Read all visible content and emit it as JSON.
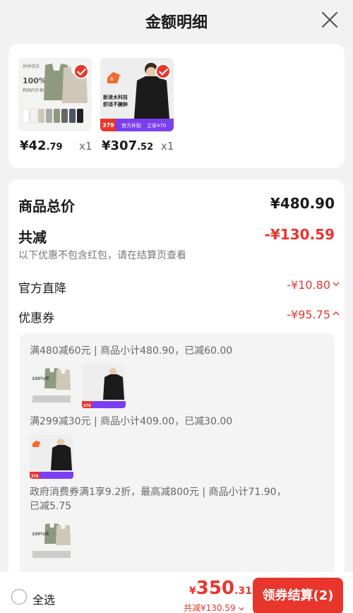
{
  "header": {
    "title": "金额明细"
  },
  "products": [
    {
      "price_main": "¥42",
      "price_frac": ".79",
      "qty": "x1",
      "badge_text": "100%棉",
      "image_desc": "vest-product-image"
    },
    {
      "price_main": "¥307",
      "price_frac": ".52",
      "qty": "x1",
      "promo_left": "379",
      "promo_mid": "官方补贴",
      "promo_right": "立省470",
      "image_desc": "jacket-product-image"
    }
  ],
  "summary": {
    "total_label": "商品总价",
    "total_value": "¥480.90",
    "reduce_label": "共减",
    "reduce_value": "-¥130.59",
    "note": "以下优惠不包含红包，请在结算页查看",
    "official_label": "官方直降",
    "official_value": "-¥10.80",
    "coupon_label": "优惠券",
    "coupon_value": "-¥95.75"
  },
  "coupon_details": [
    {
      "text": "满480减60元 | 商品小计480.90，已减60.00"
    },
    {
      "text": "满299减30元 | 商品小计409.00，已减30.00"
    },
    {
      "text_line1": "政府消费券满1享9.2折，最高减800元 | 商品小计71.90，",
      "text_line2": "已减5.75"
    }
  ],
  "bottom": {
    "select_all": "全选",
    "yen": "¥",
    "total_main": "350",
    "total_frac": ".31",
    "reduce_text": "共减¥130.59",
    "checkout_label": "领券结算(2)"
  },
  "colors": {
    "accent": "#e8362d",
    "background": "#f2f2f2",
    "card": "#ffffff"
  }
}
